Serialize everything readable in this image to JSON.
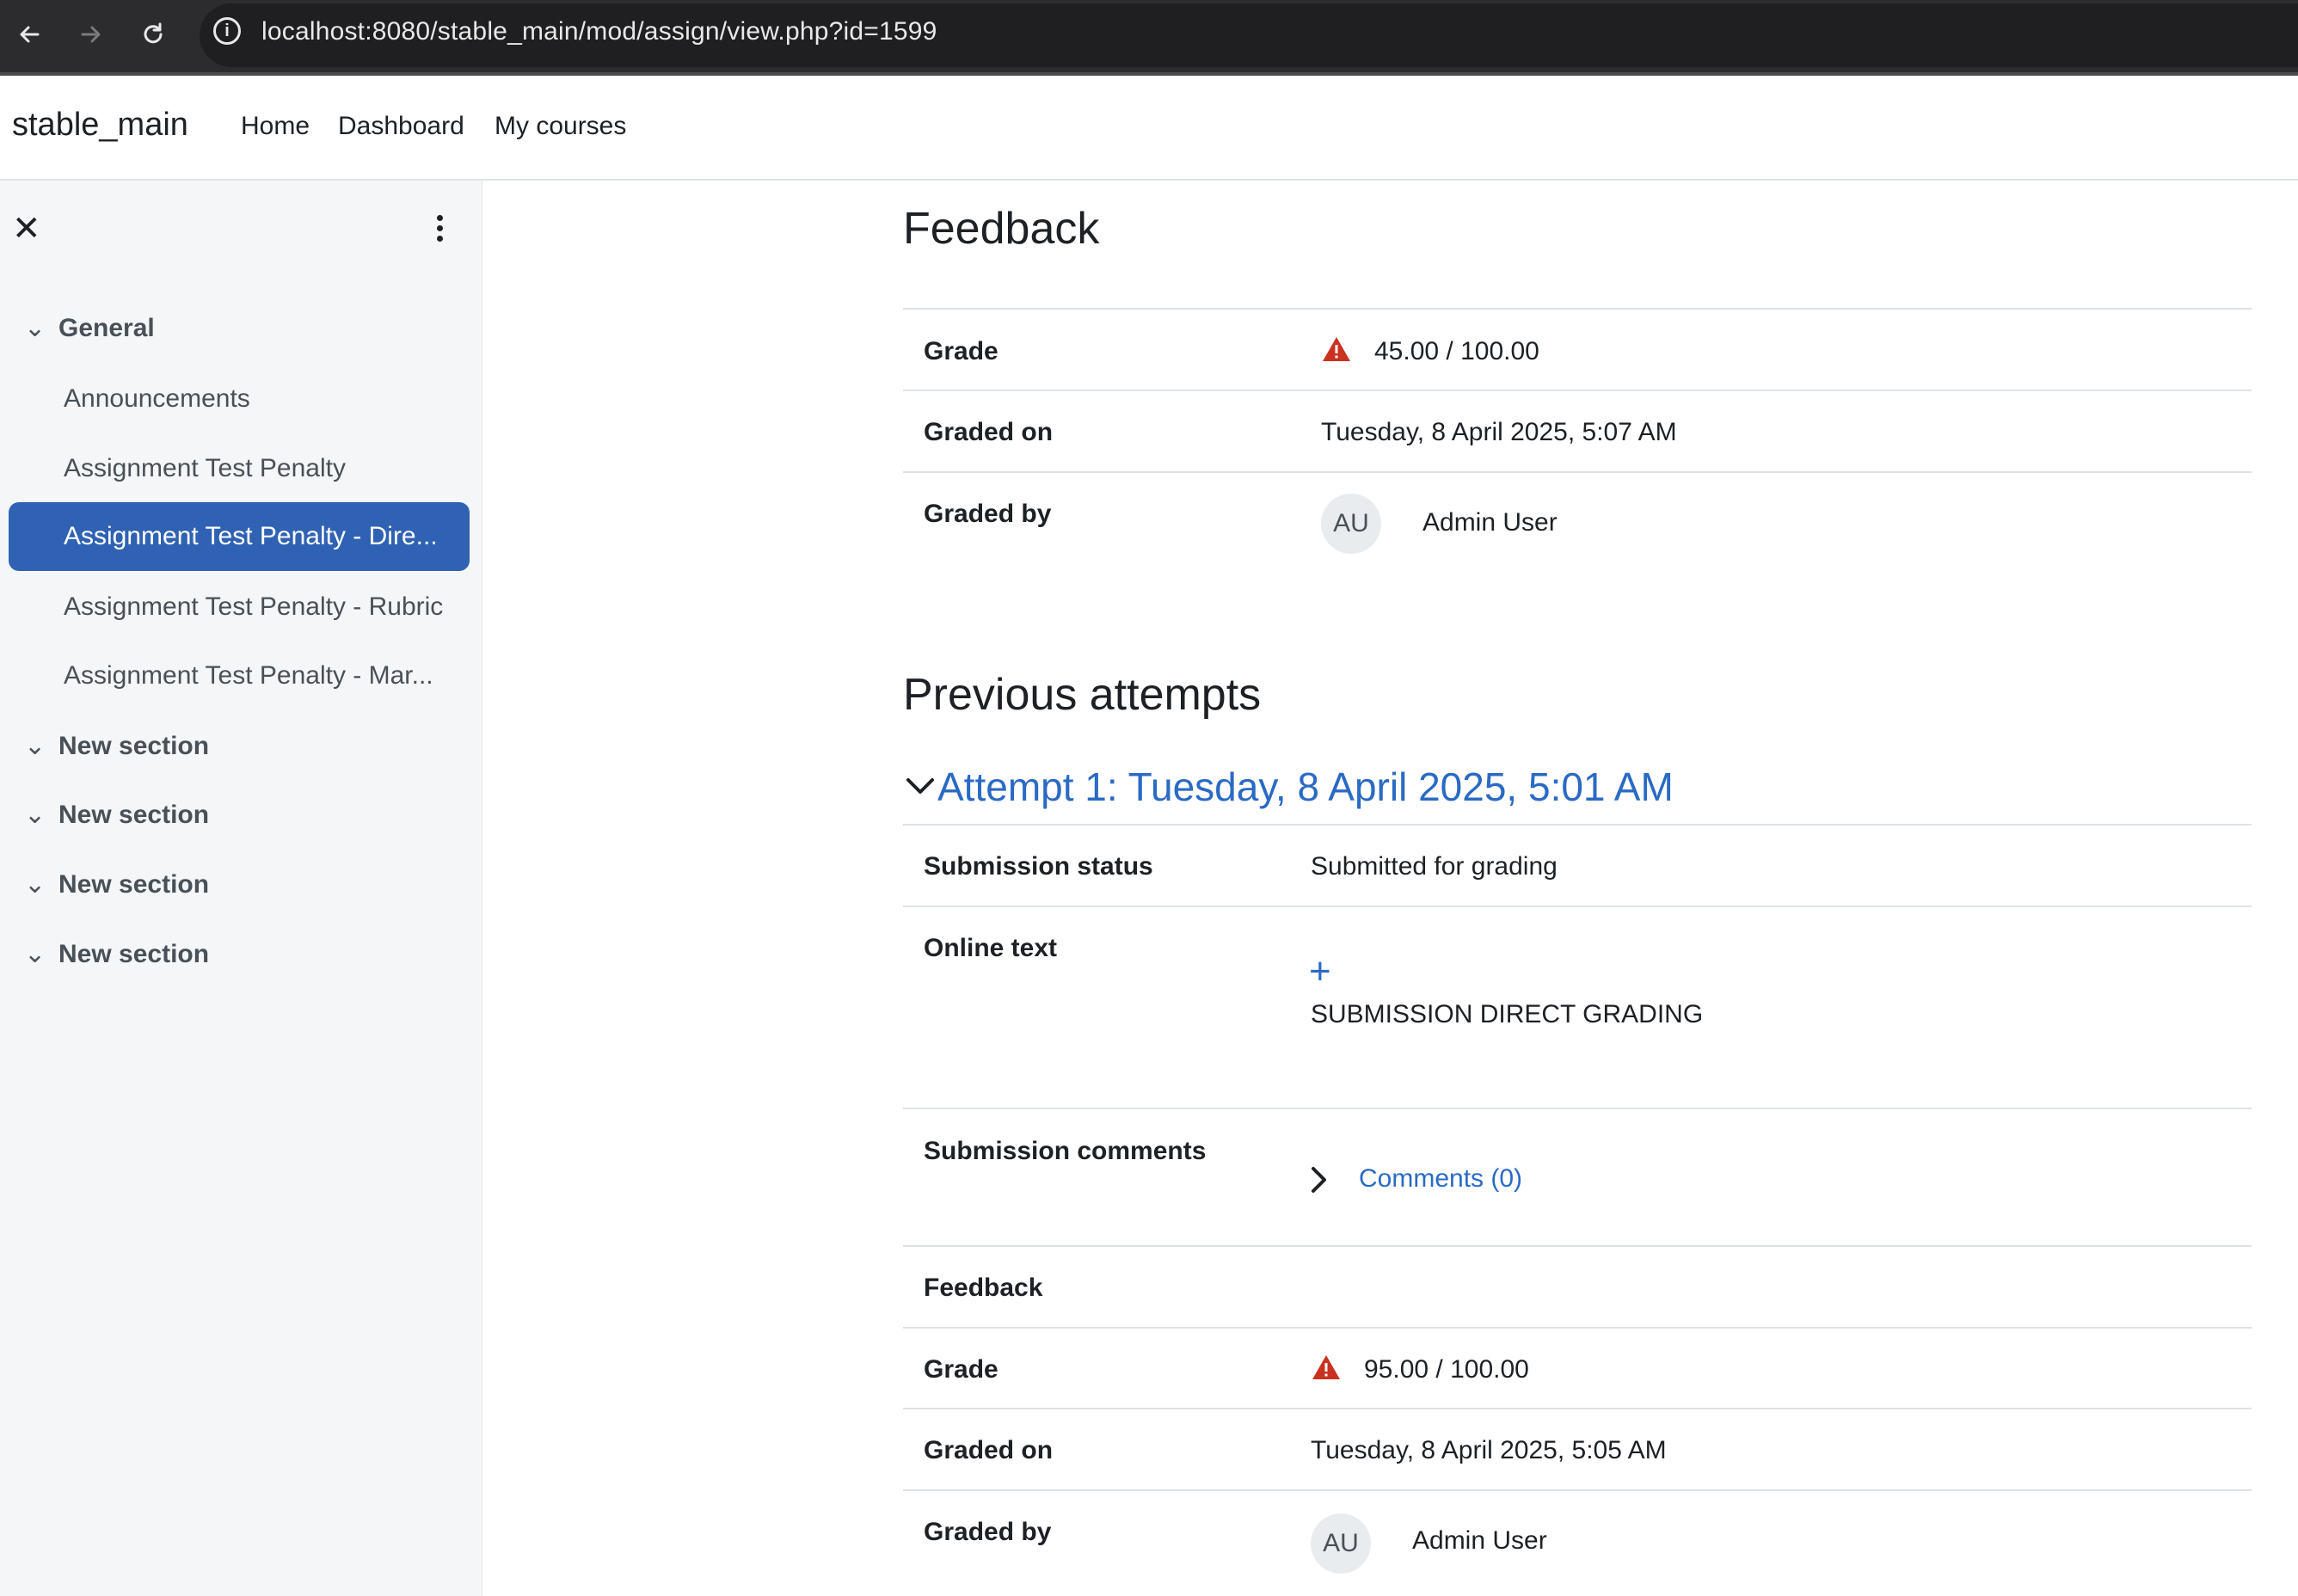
{
  "browser": {
    "url": "localhost:8080/stable_main/mod/assign/view.php?id=1599"
  },
  "navbar": {
    "brand": "stable_main",
    "links": [
      "Home",
      "Dashboard",
      "My courses"
    ]
  },
  "drawer": {
    "sections": [
      {
        "label": "General",
        "items": [
          {
            "label": "Announcements",
            "active": false
          },
          {
            "label": "Assignment Test Penalty",
            "active": false
          },
          {
            "label": "Assignment Test Penalty - Dire...",
            "active": true
          },
          {
            "label": "Assignment Test Penalty - Rubric",
            "active": false
          },
          {
            "label": "Assignment Test Penalty - Mar...",
            "active": false
          }
        ]
      },
      {
        "label": "New section",
        "items": []
      },
      {
        "label": "New section",
        "items": []
      },
      {
        "label": "New section",
        "items": []
      },
      {
        "label": "New section",
        "items": []
      }
    ]
  },
  "feedback": {
    "heading": "Feedback",
    "grade_label": "Grade",
    "grade_value": "45.00 / 100.00",
    "graded_on_label": "Graded on",
    "graded_on_value": "Tuesday, 8 April 2025, 5:07 AM",
    "graded_by_label": "Graded by",
    "grader_initials": "AU",
    "grader_name": "Admin User"
  },
  "previous": {
    "heading": "Previous attempts",
    "attempt_title": "Attempt 1: Tuesday, 8 April 2025, 5:01 AM",
    "submission_status_label": "Submission status",
    "submission_status_value": "Submitted for grading",
    "online_text_label": "Online text",
    "online_text_expand": "+",
    "online_text_value": "SUBMISSION DIRECT GRADING",
    "comments_label": "Submission comments",
    "comments_link": "Comments (0)",
    "feedback_label": "Feedback",
    "grade_label": "Grade",
    "grade_value": "95.00 / 100.00",
    "graded_on_label": "Graded on",
    "graded_on_value": "Tuesday, 8 April 2025, 5:05 AM",
    "graded_by_label": "Graded by",
    "grader_initials": "AU",
    "grader_name": "Admin User"
  },
  "colors": {
    "accent": "#3062b3",
    "link": "#2a6ac4",
    "warning": "#ca3120"
  },
  "icons": {
    "back": "back-arrow-icon",
    "forward": "forward-arrow-icon",
    "reload": "reload-icon",
    "site_info": "info-icon",
    "close": "close-icon",
    "more": "kebab-menu-icon",
    "warning": "warning-triangle-icon"
  }
}
